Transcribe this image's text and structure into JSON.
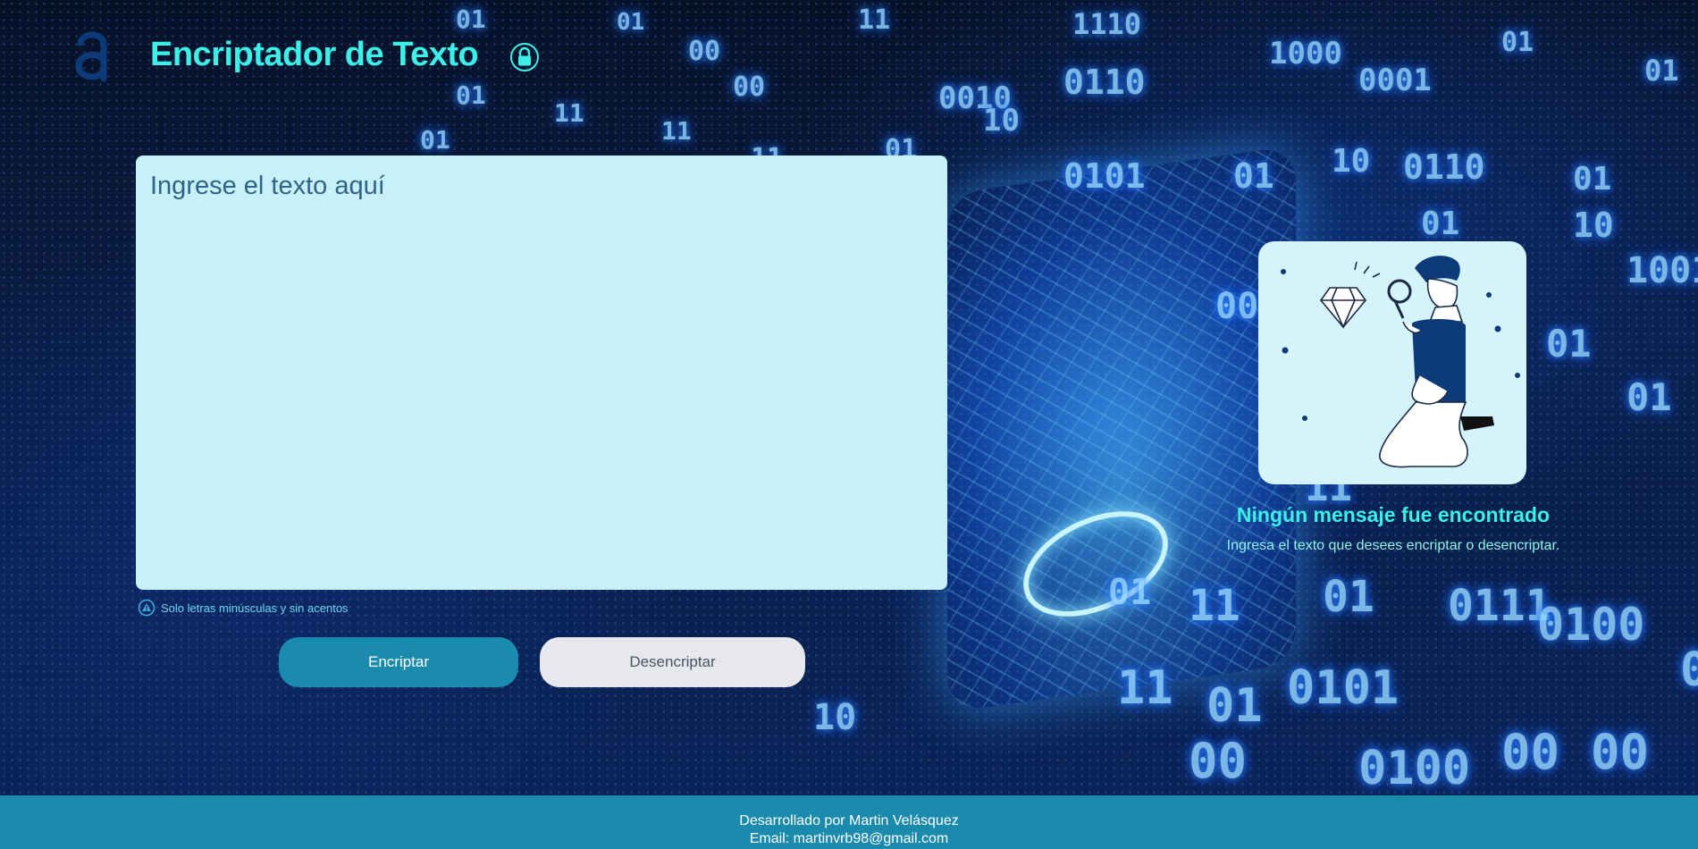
{
  "header": {
    "title": "Encriptador de Texto",
    "logo_icon": "alura-logo-icon",
    "lock_icon": "lock-icon"
  },
  "input": {
    "placeholder": "Ingrese el texto aquí",
    "value": ""
  },
  "hint": {
    "text": "Solo letras minúsculas y sin acentos",
    "icon": "warning-icon"
  },
  "buttons": {
    "encrypt_label": "Encriptar",
    "decrypt_label": "Desencriptar"
  },
  "output": {
    "title": "Ningún mensaje fue encontrado",
    "subtitle": "Ingresa el texto que desees encriptar o desencriptar.",
    "illustration": "person-with-magnifier-illustration"
  },
  "footer": {
    "developer": "Desarrollado por Martin Velásquez",
    "email": "Email: martinvrb98@gmail.com"
  },
  "colors": {
    "accent": "#3cf0e8",
    "button_primary": "#1a8aad",
    "button_secondary": "#e6e8ee",
    "input_bg": "#c8f0f8",
    "footer_bg": "#1a8aad"
  }
}
